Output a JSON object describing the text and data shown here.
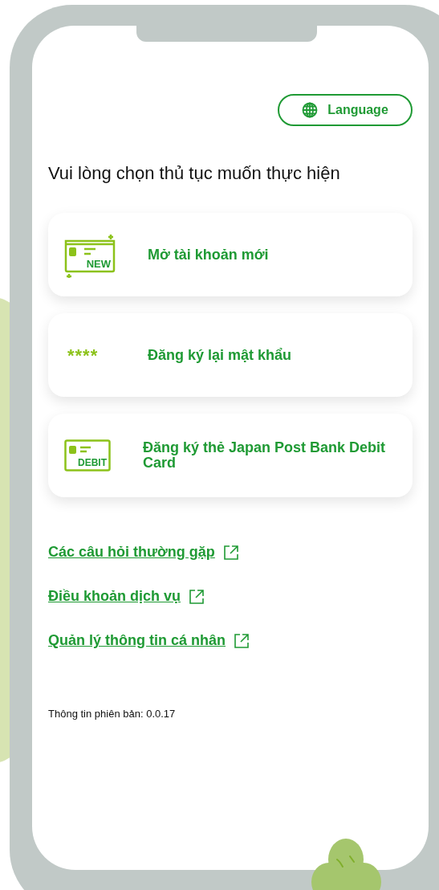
{
  "language_button": {
    "label": "Language"
  },
  "heading": "Vui lòng chọn thủ tục muốn thực hiện",
  "options": [
    {
      "kind": "new",
      "label": "Mở tài khoản mới",
      "icon_text": "NEW"
    },
    {
      "kind": "password",
      "label": "Đăng ký lại mật khẩu",
      "icon_text": "****"
    },
    {
      "kind": "debit",
      "label": "Đăng ký thẻ Japan Post Bank Debit Card",
      "icon_text": "DEBIT"
    }
  ],
  "links": [
    {
      "label": "Các câu hỏi thường gặp"
    },
    {
      "label": "Điều khoản dịch vụ"
    },
    {
      "label": "Quản lý thông tin cá nhân"
    }
  ],
  "version": "Thông tin phiên bản: 0.0.17"
}
